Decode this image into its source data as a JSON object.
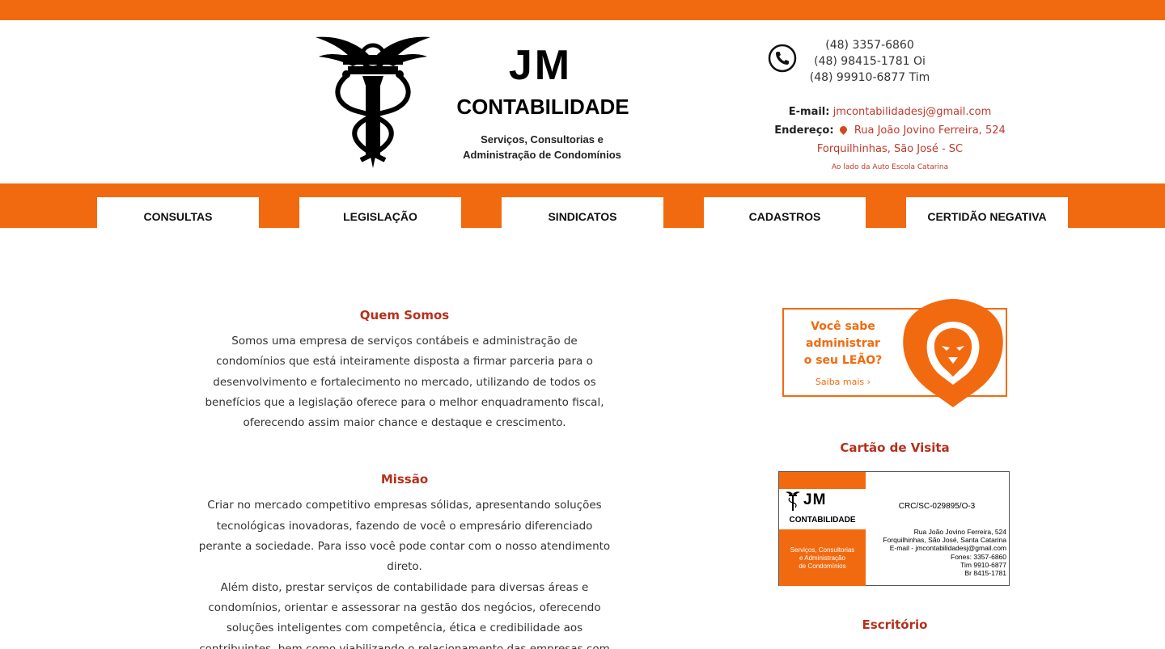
{
  "brand": {
    "initials": "JM",
    "name": "CONTABILIDADE",
    "tagline_line1": "Serviços, Consultorias e",
    "tagline_line2": "Administração de Condomínios"
  },
  "contact": {
    "phones": [
      "(48) 3357-6860",
      "(48) 98415-1781 Oi",
      "(48) 99910-6877 Tim"
    ],
    "email_label": "E-mail:",
    "email": "jmcontabilidadesj@gmail.com",
    "address_label": "Endereço:",
    "address_line1": "Rua João Jovino Ferreira, 524",
    "address_line2": "Forquilhinhas, São José - SC",
    "address_note": "Ao lado da Auto Escola Catarina"
  },
  "nav": {
    "items": [
      "CONSULTAS",
      "LEGISLAÇÃO",
      "SINDICATOS",
      "CADASTROS",
      "CERTIDÃO NEGATIVA"
    ]
  },
  "main": {
    "about_title": "Quem Somos",
    "about_text": "Somos uma empresa de serviços contábeis e administração de condomínios que está inteiramente disposta a firmar parceria para o desenvolvimento e fortalecimento no mercado, utilizando de todos os benefícios que a legislação oferece para o melhor enquadramento fiscal, oferecendo assim maior chance e destaque e crescimento.",
    "mission_title": "Missão",
    "mission_text1": "Criar no mercado competitivo empresas sólidas, apresentando soluções tecnológicas inovadoras, fazendo de você o empresário diferenciado perante a sociedade. Para isso você pode contar com o nosso atendimento direto.",
    "mission_text2": "Além disto, prestar serviços de contabilidade para diversas áreas e condomínios, orientar e assessorar na gestão dos negócios, oferecendo soluções inteligentes com competência, ética e credibilidade aos contribuintes, bem como viabilizando o relacionamento das empresas com o mercado e a geração de riqueza e renda."
  },
  "sidebar": {
    "promo_line1": "Você sabe",
    "promo_line2": "administrar",
    "promo_line3": "o seu LEÃO?",
    "promo_more": "Saiba mais ›",
    "card_title": "Cartão de Visita",
    "card": {
      "jm": "JM",
      "name": "CONTABILIDADE",
      "tag1": "Serviços, Consultorias",
      "tag2": "e Administração",
      "tag3": "de Condomínios",
      "crc": "CRC/SC-029895/O-3",
      "info": [
        "Rua João Jovino Ferreira, 524",
        "Forquilhinhas, São José, Santa Catarina",
        "E-mail - jmcontabilidadesj@gmail.com",
        "Fones: 3357-6860",
        "Tim  9910-6877",
        "Br  8415-1781"
      ]
    },
    "office_title": "Escritório"
  },
  "colors": {
    "accent": "#f26a0f",
    "title_red": "#b5301b",
    "link_red": "#c0392b"
  }
}
